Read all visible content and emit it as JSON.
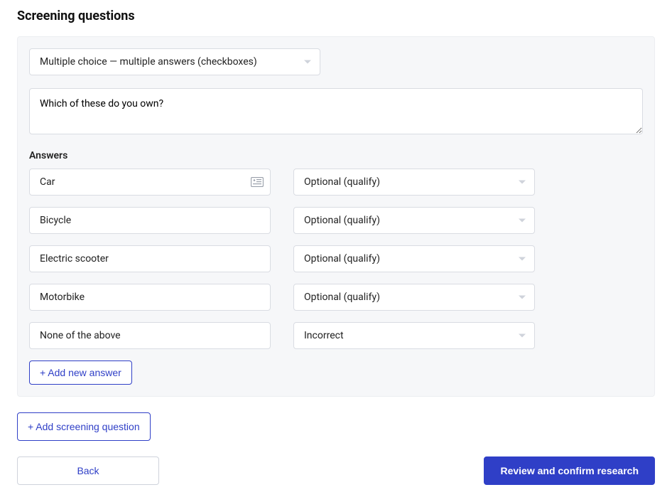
{
  "title": "Screening questions",
  "question": {
    "type_label": "Multiple choice — multiple answers (checkboxes)",
    "text": "Which of these do you own?"
  },
  "answers_label": "Answers",
  "answers": [
    {
      "text": "Car",
      "qualify": "Optional (qualify)",
      "show_media_icon": true
    },
    {
      "text": "Bicycle",
      "qualify": "Optional (qualify)",
      "show_media_icon": false
    },
    {
      "text": "Electric scooter",
      "qualify": "Optional (qualify)",
      "show_media_icon": false
    },
    {
      "text": "Motorbike",
      "qualify": "Optional (qualify)",
      "show_media_icon": false
    },
    {
      "text": "None of the above",
      "qualify": "Incorrect",
      "show_media_icon": false
    }
  ],
  "buttons": {
    "add_answer": "+ Add new answer",
    "add_screening_question": "+ Add screening question",
    "back": "Back",
    "review": "Review and confirm research"
  },
  "colors": {
    "primary": "#2f3fc7",
    "panel_bg": "#f6f7f9",
    "border": "#d9dce2"
  }
}
